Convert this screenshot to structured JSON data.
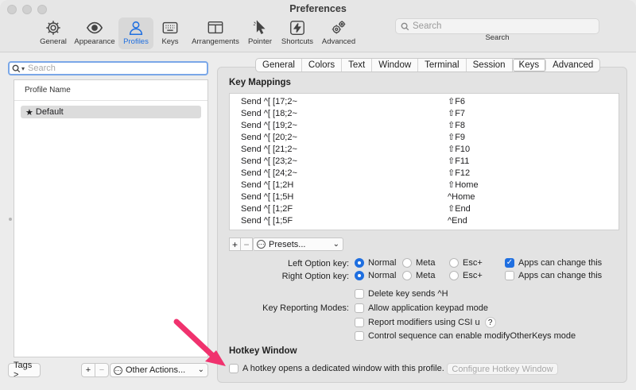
{
  "window": {
    "title": "Preferences"
  },
  "toolbar": {
    "items": [
      {
        "label": "General",
        "icon": "gear-icon"
      },
      {
        "label": "Appearance",
        "icon": "eye-icon"
      },
      {
        "label": "Profiles",
        "icon": "person-icon"
      },
      {
        "label": "Keys",
        "icon": "keyboard-icon"
      },
      {
        "label": "Arrangements",
        "icon": "windows-icon"
      },
      {
        "label": "Pointer",
        "icon": "cursor-icon"
      },
      {
        "label": "Shortcuts",
        "icon": "lightning-icon"
      },
      {
        "label": "Advanced",
        "icon": "gears-icon"
      }
    ],
    "active": "Profiles",
    "search_placeholder": "Search",
    "search_caption": "Search"
  },
  "profiles": {
    "search_placeholder": "Search",
    "column_header": "Profile Name",
    "items": [
      {
        "name": "Default",
        "star": "★"
      }
    ],
    "tags_button": "Tags >",
    "add": "+",
    "remove": "−",
    "other_actions": "Other Actions...",
    "other_actions_icon": "⋯",
    "chevron": "⌄"
  },
  "tabs": {
    "items": [
      "General",
      "Colors",
      "Text",
      "Window",
      "Terminal",
      "Session",
      "Keys",
      "Advanced"
    ],
    "active": "Keys"
  },
  "key_mappings": {
    "title": "Key Mappings",
    "rows": [
      {
        "action": "Send ^[ [17;2~",
        "key": "⇧F6"
      },
      {
        "action": "Send ^[ [18;2~",
        "key": "⇧F7"
      },
      {
        "action": "Send ^[ [19;2~",
        "key": "⇧F8"
      },
      {
        "action": "Send ^[ [20;2~",
        "key": "⇧F9"
      },
      {
        "action": "Send ^[ [21;2~",
        "key": "⇧F10"
      },
      {
        "action": "Send ^[ [23;2~",
        "key": "⇧F11"
      },
      {
        "action": "Send ^[ [24;2~",
        "key": "⇧F12"
      },
      {
        "action": "Send ^[ [1;2H",
        "key": "⇧Home"
      },
      {
        "action": "Send ^[ [1;5H",
        "key": "^Home"
      },
      {
        "action": "Send ^[ [1;2F",
        "key": "⇧End"
      },
      {
        "action": "Send ^[ [1;5F",
        "key": "^End"
      }
    ],
    "add": "+",
    "remove": "−",
    "presets": "Presets...",
    "presets_icon": "⋯",
    "chevron": "⌄"
  },
  "option_keys": {
    "left_label": "Left Option key:",
    "right_label": "Right Option key:",
    "choices": [
      "Normal",
      "Meta",
      "Esc+"
    ],
    "left_selected": "Normal",
    "right_selected": "Normal",
    "apps_change": "Apps can change this",
    "left_apps_checked": true,
    "right_apps_checked": false
  },
  "reporting": {
    "delete_sends": "Delete key sends ^H",
    "label": "Key Reporting Modes:",
    "keypad": "Allow application keypad mode",
    "csi_u": "Report modifiers using CSI u",
    "help": "?",
    "modify_other": "Control sequence can enable modifyOtherKeys mode"
  },
  "hotkey": {
    "title": "Hotkey Window",
    "checkbox": "A hotkey opens a dedicated window with this profile.",
    "configure": "Configure Hotkey Window"
  },
  "colors": {
    "accent": "#1f6fe0",
    "annotation_arrow": "#f0326e"
  }
}
